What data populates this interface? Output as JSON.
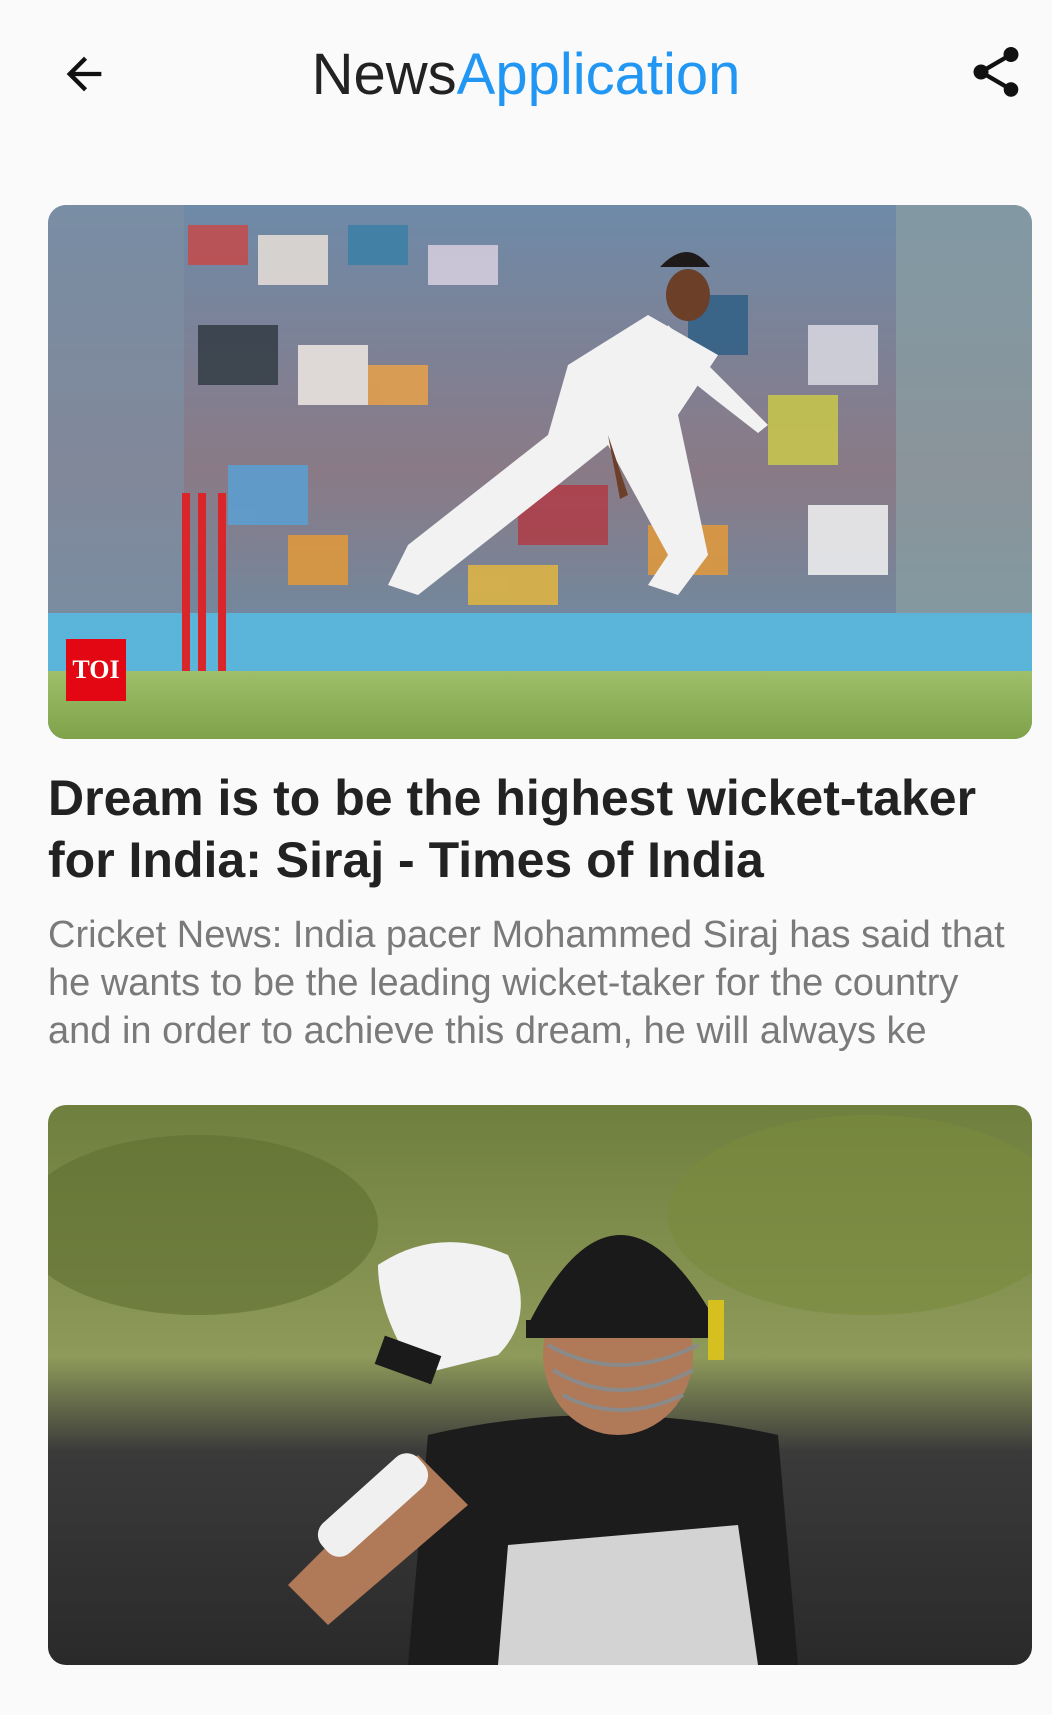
{
  "app_bar": {
    "title_part1": "News",
    "title_part2": "Application",
    "accent_color": "#2196f3",
    "back_icon": "arrow-left-icon",
    "share_icon": "share-icon"
  },
  "articles": [
    {
      "image_alt": "Cricket bowler in white test kit in follow-through",
      "image_badge": "TOI",
      "title": "Dream is to be the highest wicket-taker for India: Siraj - Times of India",
      "description": "Cricket News: India pacer Mohammed Siraj has said that he wants to be the leading wicket-taker for the country and in order to achieve this dream, he will always ke"
    },
    {
      "image_alt": "New Zealand cricketer in helmet adjusting gear"
    }
  ]
}
